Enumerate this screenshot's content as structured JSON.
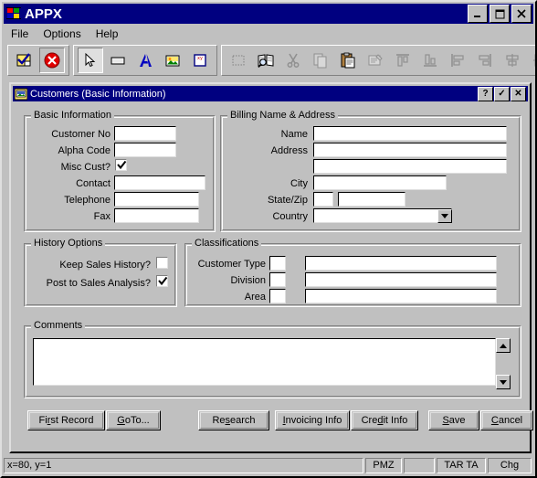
{
  "window": {
    "title": "APPX",
    "icon": "windows-logo-icon",
    "controls": [
      {
        "name": "minimize",
        "glyph": "_"
      },
      {
        "name": "maximize",
        "glyph": "□"
      },
      {
        "name": "close",
        "glyph": "✕"
      }
    ]
  },
  "menubar": {
    "items": [
      {
        "label": "File"
      },
      {
        "label": "Options"
      },
      {
        "label": "Help"
      }
    ]
  },
  "toolbar": {
    "groups": [
      {
        "buttons": [
          {
            "name": "accept-icon",
            "state": "normal"
          },
          {
            "name": "cancel-icon",
            "state": "pressed"
          }
        ]
      },
      {
        "buttons": [
          {
            "name": "pointer-icon",
            "state": "selected"
          },
          {
            "name": "rectangle-icon",
            "state": "normal"
          },
          {
            "name": "text-tool-icon",
            "state": "normal"
          },
          {
            "name": "image-icon",
            "state": "normal"
          },
          {
            "name": "xy-field-icon",
            "state": "normal"
          }
        ]
      },
      {
        "buttons": [
          {
            "name": "select-all-icon",
            "state": "disabled"
          },
          {
            "name": "find-icon",
            "state": "normal"
          },
          {
            "name": "cut-icon",
            "state": "disabled"
          },
          {
            "name": "copy-icon",
            "state": "disabled"
          },
          {
            "name": "paste-icon",
            "state": "normal"
          },
          {
            "name": "properties-icon",
            "state": "disabled"
          },
          {
            "name": "align-top-icon",
            "state": "disabled"
          },
          {
            "name": "align-bottom-icon",
            "state": "disabled"
          },
          {
            "name": "align-left-icon",
            "state": "disabled"
          },
          {
            "name": "align-right-icon",
            "state": "disabled"
          },
          {
            "name": "align-center-h-icon",
            "state": "disabled"
          },
          {
            "name": "align-center-v-icon",
            "state": "disabled"
          }
        ]
      }
    ]
  },
  "inner_window": {
    "title": "Customers (Basic Information)",
    "icon": "form-window-icon",
    "controls": [
      {
        "name": "help",
        "glyph": "?"
      },
      {
        "name": "ok",
        "glyph": "✓"
      },
      {
        "name": "close",
        "glyph": "✕"
      }
    ]
  },
  "basic_information": {
    "legend": "Basic Information",
    "fields": [
      {
        "label": "Customer No",
        "value": "",
        "type": "text"
      },
      {
        "label": "Alpha Code",
        "value": "",
        "type": "text"
      },
      {
        "label": "Misc Cust?",
        "value": "",
        "type": "checkbox",
        "checked": true
      },
      {
        "label": "Contact",
        "value": "",
        "type": "text"
      },
      {
        "label": "Telephone",
        "value": "",
        "type": "text"
      },
      {
        "label": "Fax",
        "value": "",
        "type": "text"
      }
    ]
  },
  "billing": {
    "legend": "Billing Name & Address",
    "fields": [
      {
        "label": "Name",
        "value": "",
        "type": "text"
      },
      {
        "label": "Address",
        "value": "",
        "type": "text"
      },
      {
        "label": "",
        "value": "",
        "type": "text"
      },
      {
        "label": "City",
        "value": "",
        "type": "text"
      },
      {
        "label": "State/Zip",
        "value": "",
        "type": "text"
      },
      {
        "label": "Country",
        "value": "",
        "type": "combo"
      }
    ],
    "state_value": "",
    "zip_value": "",
    "country_value": ""
  },
  "history_options": {
    "legend": "History Options",
    "fields": [
      {
        "label": "Keep Sales History?",
        "checked": false
      },
      {
        "label": "Post to Sales Analysis?",
        "checked": true
      }
    ]
  },
  "classifications": {
    "legend": "Classifications",
    "rows": [
      {
        "label": "Customer Type",
        "code": "",
        "description": ""
      },
      {
        "label": "Division",
        "code": "",
        "description": ""
      },
      {
        "label": "Area",
        "code": "",
        "description": ""
      }
    ]
  },
  "comments": {
    "legend": "Comments",
    "value": ""
  },
  "buttons": [
    {
      "name": "first-record-button",
      "label": "First Record",
      "accel_index": 3
    },
    {
      "name": "goto-button",
      "label": "GoTo...",
      "accel_index": 1
    },
    {
      "name": "research-button",
      "label": "Research",
      "accel_index": 2
    },
    {
      "name": "invoicing-info-button",
      "label": "Invoicing Info",
      "accel_index": 0
    },
    {
      "name": "credit-info-button",
      "label": "Credit Info",
      "accel_index": 4
    },
    {
      "name": "save-button",
      "label": "Save",
      "accel_index": 0
    },
    {
      "name": "cancel-button",
      "label": "Cancel",
      "accel_index": 0
    }
  ],
  "statusbar": {
    "coordinates": "x=80, y=1",
    "panel2": "PMZ",
    "panel3": "",
    "panel4": "TAR TA",
    "panel5": "Chg"
  },
  "colors": {
    "titlebar": "#000080",
    "face": "#c0c0c0",
    "field": "#ffffff",
    "text": "#000000"
  }
}
